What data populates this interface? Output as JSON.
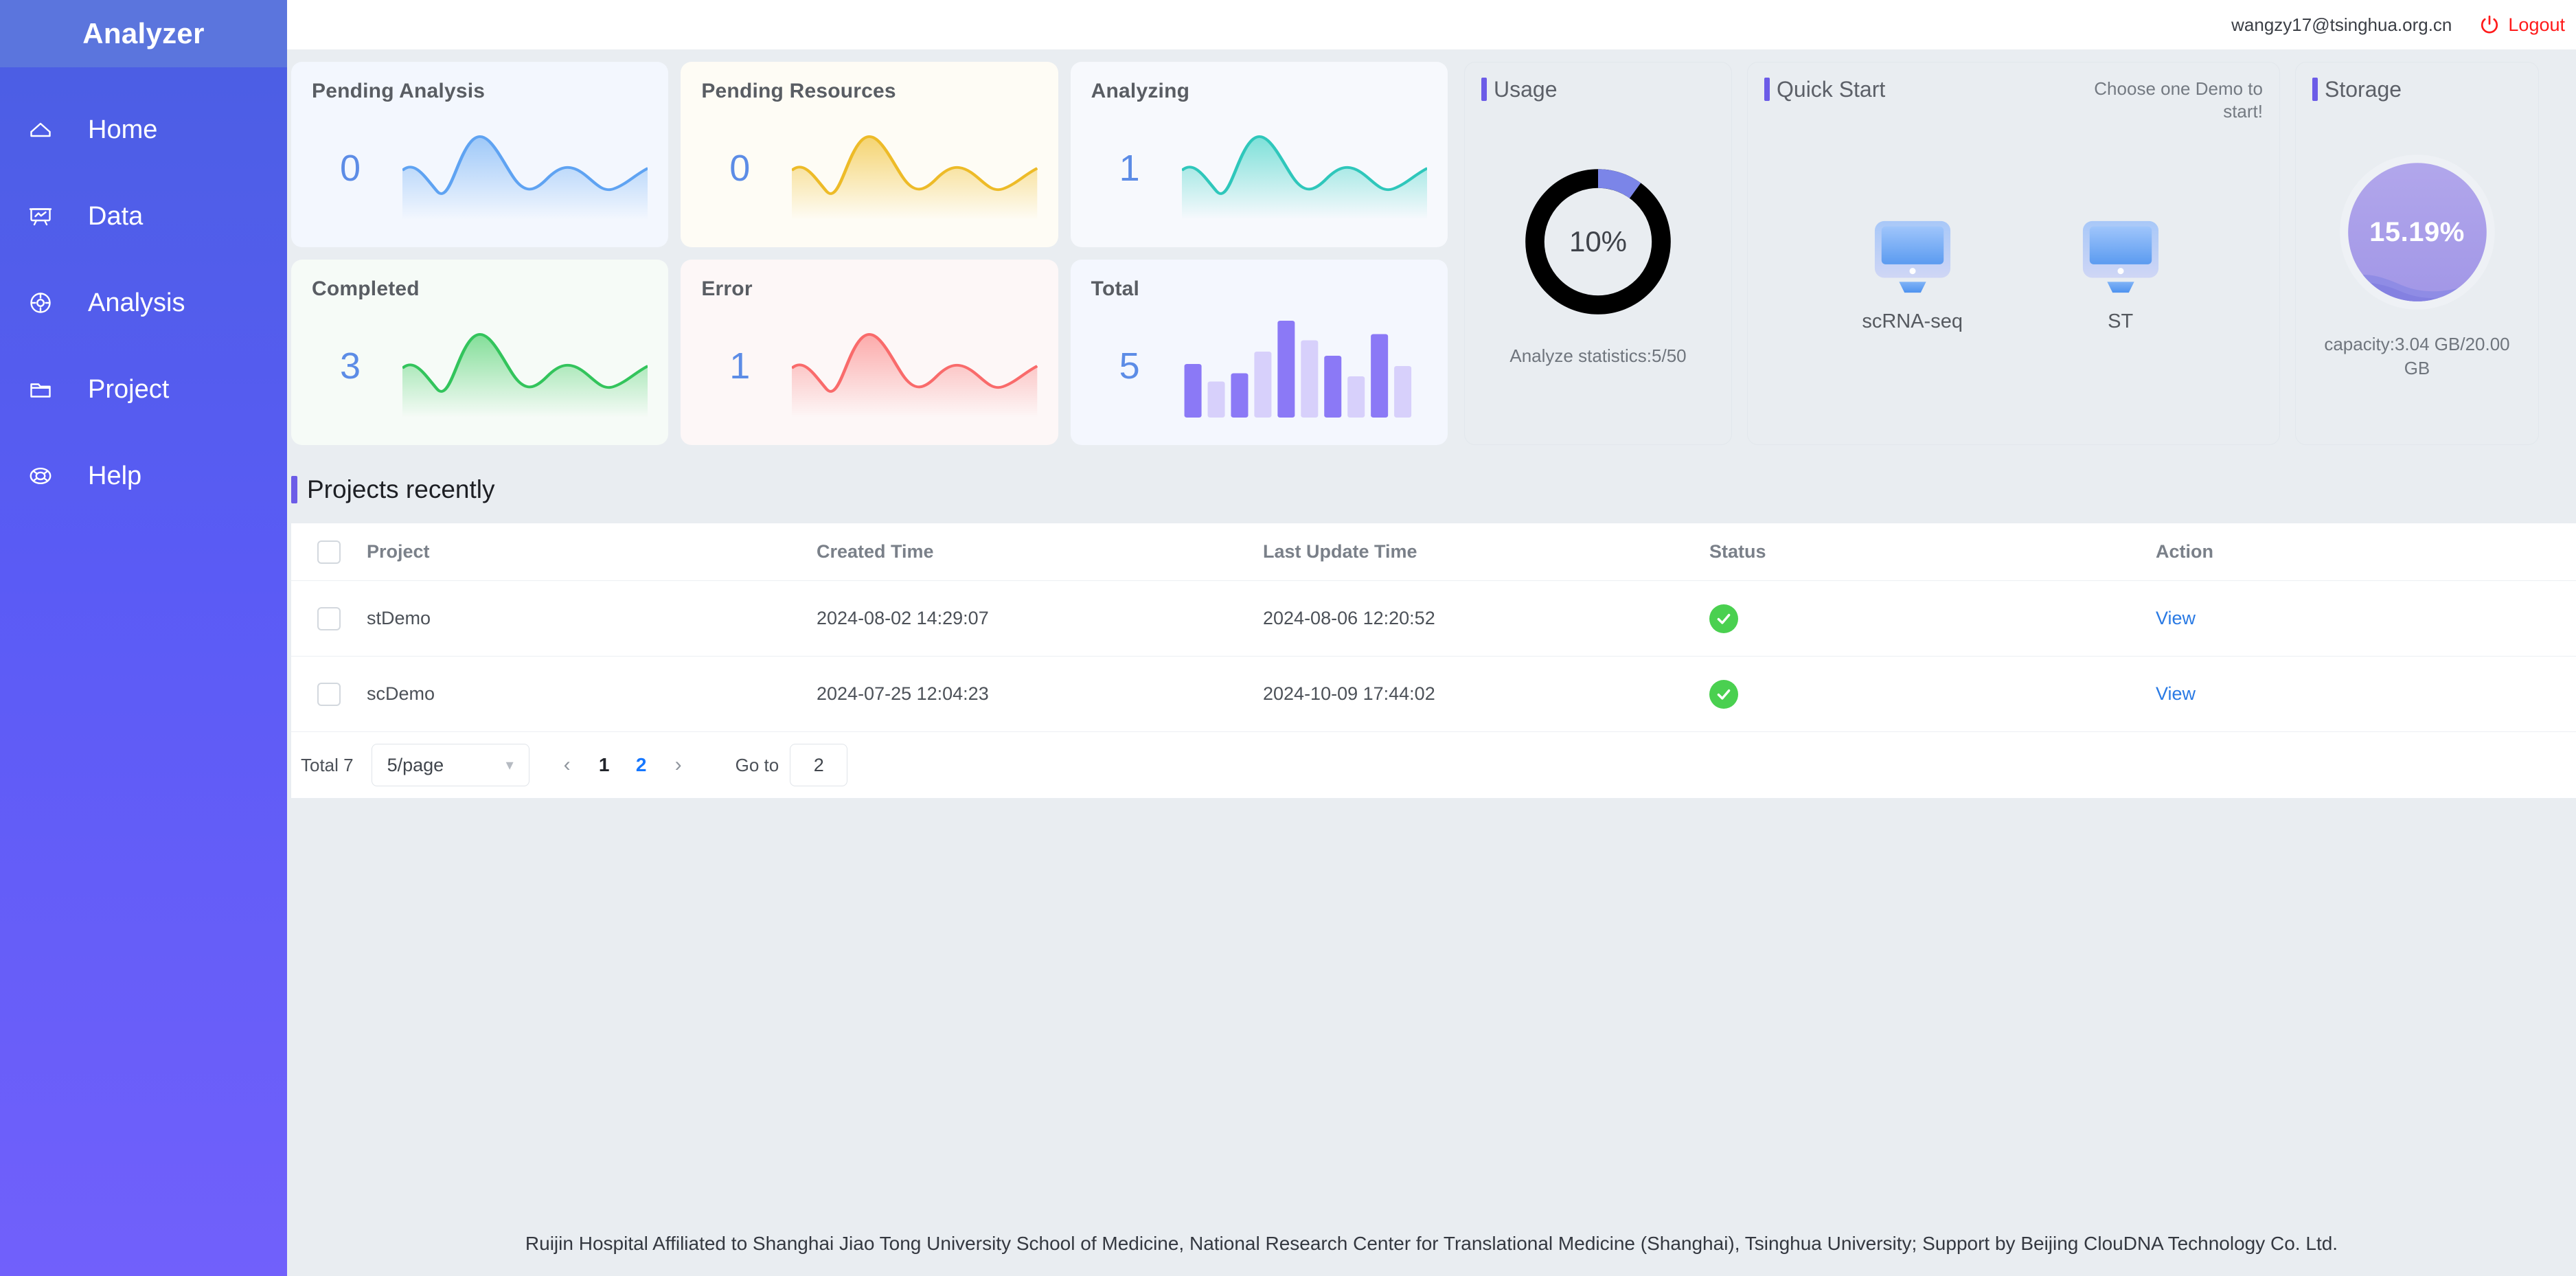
{
  "sidebar": {
    "brand": "Analyzer",
    "items": [
      {
        "label": "Home",
        "icon": "home-icon"
      },
      {
        "label": "Data",
        "icon": "presentation-chart-icon"
      },
      {
        "label": "Analysis",
        "icon": "target-icon"
      },
      {
        "label": "Project",
        "icon": "folder-icon"
      },
      {
        "label": "Help",
        "icon": "lifebuoy-icon"
      }
    ]
  },
  "topbar": {
    "user_email": "wangzy17@tsinghua.org.cn",
    "logout_label": "Logout",
    "logout_icon": "power-icon"
  },
  "stats": [
    {
      "title": "Pending Analysis",
      "value": "0",
      "color": "#6aa6f0",
      "theme": "c-blue",
      "spark": "wave"
    },
    {
      "title": "Pending Resources",
      "value": "0",
      "color": "#f0c33c",
      "theme": "c-yellow",
      "spark": "wave"
    },
    {
      "title": "Analyzing",
      "value": "1",
      "color": "#3ed0c4",
      "theme": "c-teal",
      "spark": "wave"
    },
    {
      "title": "Completed",
      "value": "3",
      "color": "#3fc463",
      "theme": "c-green",
      "spark": "wave"
    },
    {
      "title": "Error",
      "value": "1",
      "color": "#fa6a6a",
      "theme": "c-red",
      "spark": "wave"
    },
    {
      "title": "Total",
      "value": "5",
      "color": "#7f6cf5",
      "theme": "c-purple",
      "spark": "bars"
    }
  ],
  "usage": {
    "title": "Usage",
    "percent_label": "10%",
    "percent_value": 10,
    "caption": "Analyze statistics:5/50",
    "ring_color": "#7b85e8",
    "track_color": "#000000"
  },
  "quick_start": {
    "title": "Quick Start",
    "hint": "Choose one Demo to start!",
    "demos": [
      {
        "label": "scRNA-seq",
        "icon": "monitor-icon"
      },
      {
        "label": "ST",
        "icon": "monitor-icon"
      }
    ]
  },
  "storage": {
    "title": "Storage",
    "percent_label": "15.19%",
    "percent_value": 15.19,
    "caption": "capacity:3.04 GB/20.00 GB",
    "fill_color": "#a79ae8"
  },
  "projects": {
    "title": "Projects recently",
    "columns": [
      "Project",
      "Created Time",
      "Last Update Time",
      "Status",
      "Action"
    ],
    "rows": [
      {
        "project": "stDemo",
        "created": "2024-08-02 14:29:07",
        "updated": "2024-08-06 12:20:52",
        "status": "success",
        "action": "View"
      },
      {
        "project": "scDemo",
        "created": "2024-07-25 12:04:23",
        "updated": "2024-10-09 17:44:02",
        "status": "success",
        "action": "View"
      }
    ],
    "pagination": {
      "total_label": "Total 7",
      "page_size": "5/page",
      "prev_icon": "chevron-left-icon",
      "next_icon": "chevron-right-icon",
      "pages": [
        "1",
        "2"
      ],
      "active_page": "2",
      "goto_label": "Go to",
      "goto_value": "2"
    }
  },
  "footer": {
    "text": "Ruijin Hospital Affiliated to Shanghai Jiao Tong University School of Medicine, National Research Center for Translational Medicine (Shanghai), Tsinghua University; Support by Beijing ClouDNA Technology Co. Ltd."
  }
}
